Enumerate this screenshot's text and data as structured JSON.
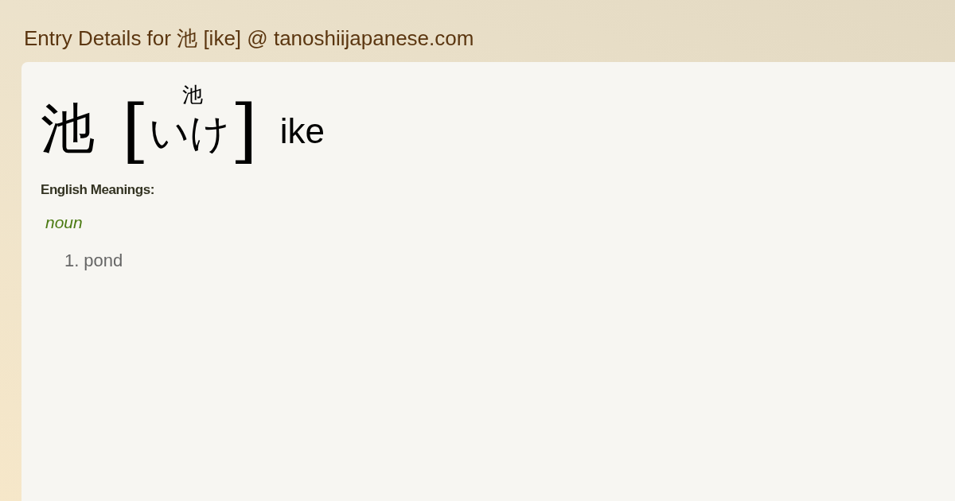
{
  "page_title": "Entry Details for 池 [ike] @ tanoshiijapanese.com",
  "entry": {
    "headword": "池",
    "bracket_open": "[",
    "furigana": "池",
    "kana": "いけ",
    "bracket_close": "]",
    "romaji": "ike"
  },
  "meanings_heading": "English Meanings:",
  "senses": [
    {
      "part_of_speech": "noun",
      "definitions": [
        {
          "number": "1.",
          "text": "pond"
        }
      ]
    }
  ]
}
